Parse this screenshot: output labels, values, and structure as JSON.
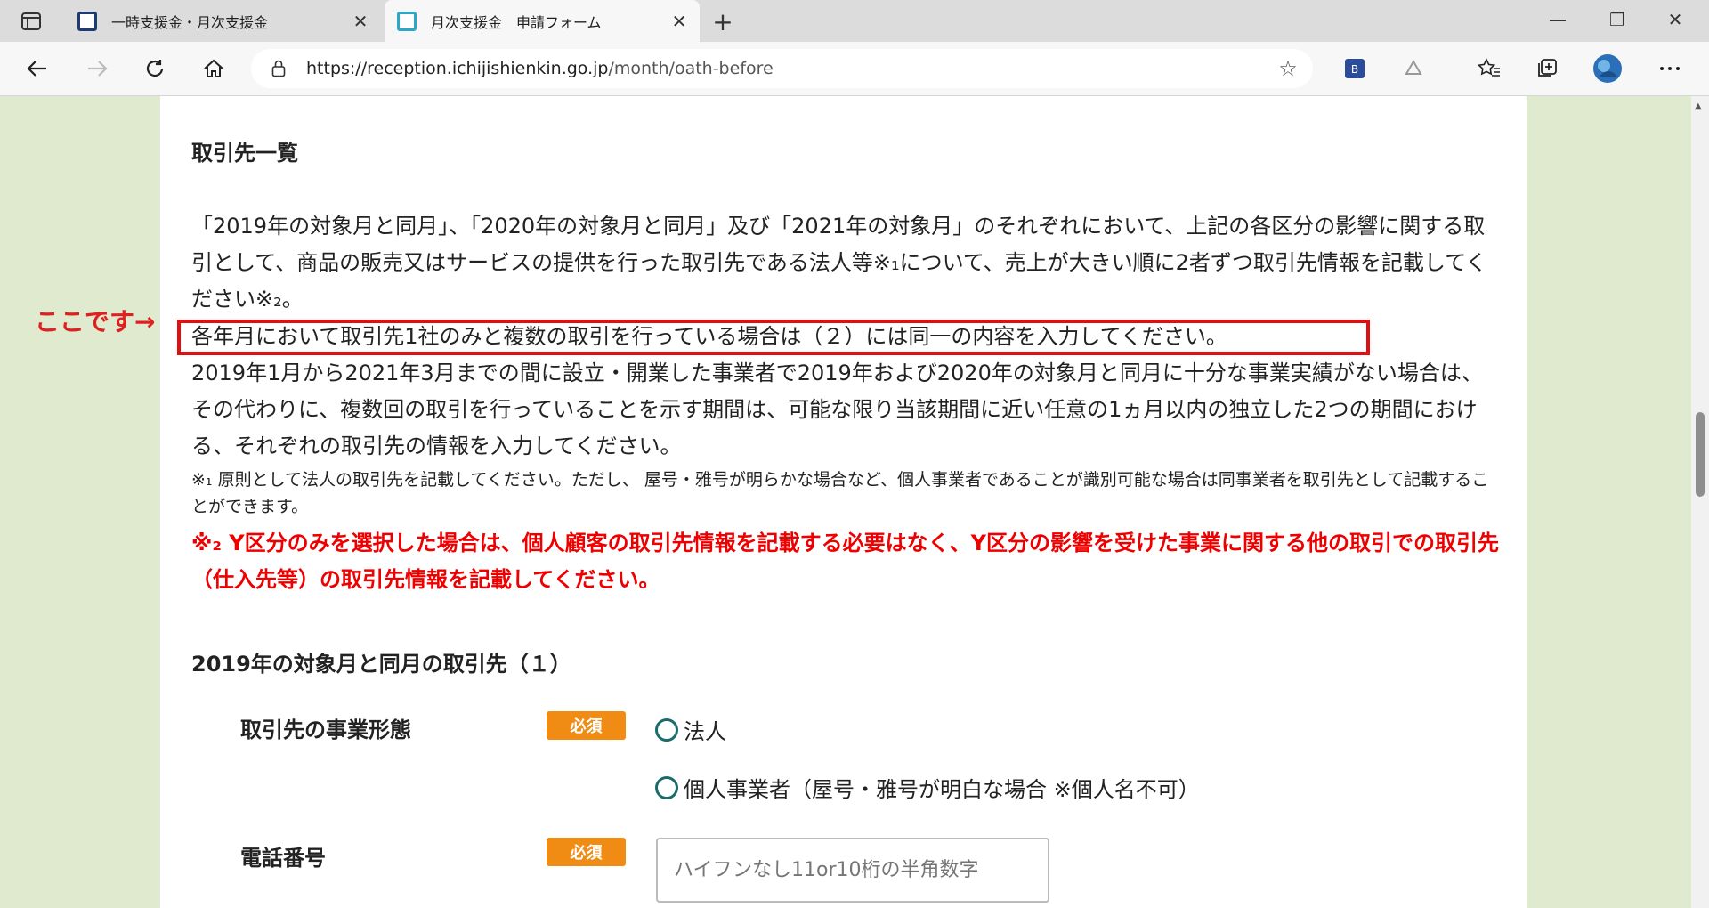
{
  "tabs": [
    {
      "title": "一時支援金・月次支援金",
      "active": false
    },
    {
      "title": "月次支援金　申請フォーム",
      "active": true
    }
  ],
  "address": {
    "host": "https://reception.ichijishienkin.go.jp",
    "path": "/month/oath-before"
  },
  "page": {
    "section_title": "取引先一覧",
    "para1": "「2019年の対象月と同月」、「2020年の対象月と同月」及び「2021年の対象月」のそれぞれにおいて、上記の各区分の影響に関する取引として、商品の販売又はサービスの提供を行った取引先である法人等※₁について、売上が大きい順に2者ずつ取引先情報を記載してください※₂。",
    "highlight_line": "各年月において取引先1社のみと複数の取引を行っている場合は（２）には同一の内容を入力してください。",
    "para2": "2019年1月から2021年3月までの間に設立・開業した事業者で2019年および2020年の対象月と同月に十分な事業実績がない場合は、その代わりに、複数回の取引を行っていることを示す期間は、可能な限り当該期間に近い任意の1ヵ月以内の独立した2つの期間における、それぞれの取引先の情報を入力してください。",
    "note1": "※₁ 原則として法人の取引先を記載してください。ただし、 屋号・雅号が明らかな場合など、個人事業者であることが識別可能な場合は同事業者を取引先として記載することができます。",
    "note2": "※₂ Y区分のみを選択した場合は、個人顧客の取引先情報を記載する必要はなく、Y区分の影響を受けた事業に関する他の取引での取引先（仕入先等）の取引先情報を記載してください。",
    "callout": "ここです→",
    "subsection_title": "2019年の対象月と同月の取引先（１）",
    "business_type_label": "取引先の事業形態",
    "required_badge": "必須",
    "radio_corporation": "法人",
    "radio_individual": "個人事業者（屋号・雅号が明白な場合 ※個人名不可）",
    "phone_label": "電話番号",
    "phone_placeholder": "ハイフンなし11or10桁の半角数字"
  }
}
